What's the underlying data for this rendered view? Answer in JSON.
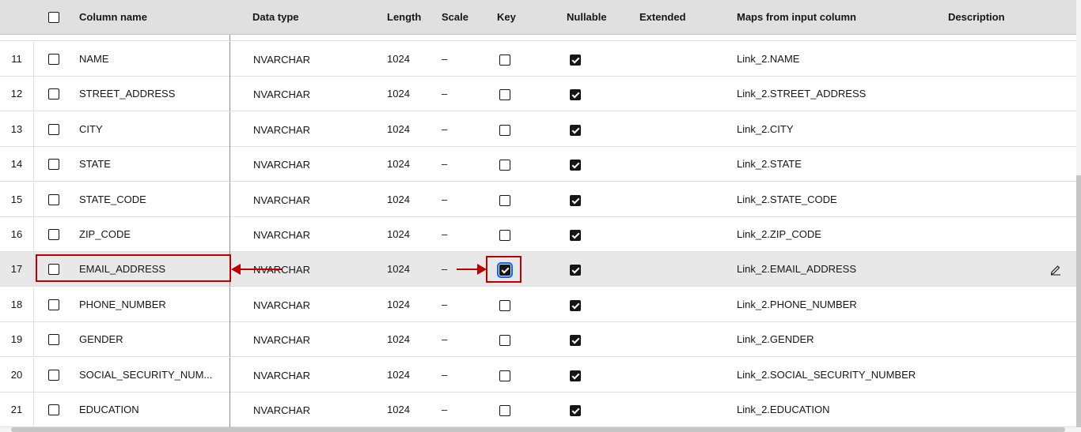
{
  "header": {
    "column_name": "Column name",
    "data_type": "Data type",
    "length": "Length",
    "scale": "Scale",
    "key": "Key",
    "nullable": "Nullable",
    "extended": "Extended",
    "maps_from": "Maps from input column",
    "description": "Description"
  },
  "rows": [
    {
      "num": "11",
      "name": "NAME",
      "dtype": "NVARCHAR",
      "length": "1024",
      "scale": "–",
      "key": false,
      "nullable": true,
      "maps": "Link_2.NAME"
    },
    {
      "num": "12",
      "name": "STREET_ADDRESS",
      "dtype": "NVARCHAR",
      "length": "1024",
      "scale": "–",
      "key": false,
      "nullable": true,
      "maps": "Link_2.STREET_ADDRESS"
    },
    {
      "num": "13",
      "name": "CITY",
      "dtype": "NVARCHAR",
      "length": "1024",
      "scale": "–",
      "key": false,
      "nullable": true,
      "maps": "Link_2.CITY"
    },
    {
      "num": "14",
      "name": "STATE",
      "dtype": "NVARCHAR",
      "length": "1024",
      "scale": "–",
      "key": false,
      "nullable": true,
      "maps": "Link_2.STATE"
    },
    {
      "num": "15",
      "name": "STATE_CODE",
      "dtype": "NVARCHAR",
      "length": "1024",
      "scale": "–",
      "key": false,
      "nullable": true,
      "maps": "Link_2.STATE_CODE"
    },
    {
      "num": "16",
      "name": "ZIP_CODE",
      "dtype": "NVARCHAR",
      "length": "1024",
      "scale": "–",
      "key": false,
      "nullable": true,
      "maps": "Link_2.ZIP_CODE"
    },
    {
      "num": "17",
      "name": "EMAIL_ADDRESS",
      "dtype": "NVARCHAR",
      "length": "1024",
      "scale": "–",
      "key": true,
      "nullable": true,
      "maps": "Link_2.EMAIL_ADDRESS"
    },
    {
      "num": "18",
      "name": "PHONE_NUMBER",
      "dtype": "NVARCHAR",
      "length": "1024",
      "scale": "–",
      "key": false,
      "nullable": true,
      "maps": "Link_2.PHONE_NUMBER"
    },
    {
      "num": "19",
      "name": "GENDER",
      "dtype": "NVARCHAR",
      "length": "1024",
      "scale": "–",
      "key": false,
      "nullable": true,
      "maps": "Link_2.GENDER"
    },
    {
      "num": "20",
      "name": "SOCIAL_SECURITY_NUM...",
      "dtype": "NVARCHAR",
      "length": "1024",
      "scale": "–",
      "key": false,
      "nullable": true,
      "maps": "Link_2.SOCIAL_SECURITY_NUMBER"
    },
    {
      "num": "21",
      "name": "EDUCATION",
      "dtype": "NVARCHAR",
      "length": "1024",
      "scale": "–",
      "key": false,
      "nullable": true,
      "maps": "Link_2.EDUCATION"
    }
  ],
  "selected_row": "17",
  "edit_icon": "edit-pencil-icon",
  "annotation_color": "#c00000"
}
